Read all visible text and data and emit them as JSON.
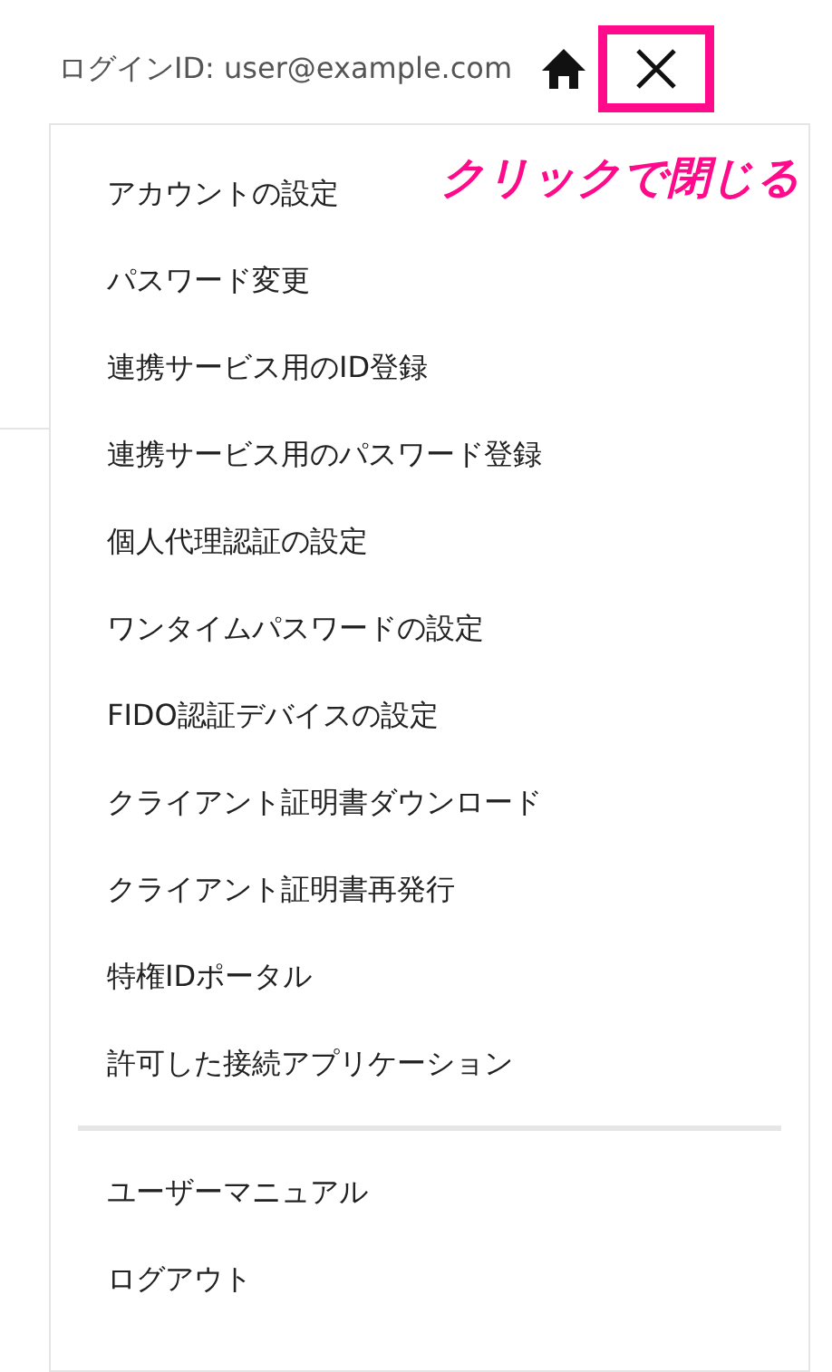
{
  "header": {
    "login_id": "ログインID: user@example.com"
  },
  "callout": {
    "text": "クリックで閉じる"
  },
  "menu": {
    "groups": [
      {
        "items": [
          "アカウントの設定",
          "パスワード変更",
          "連携サービス用のID登録",
          "連携サービス用のパスワード登録",
          "個人代理認証の設定",
          "ワンタイムパスワードの設定",
          "FIDO認証デバイスの設定",
          "クライアント証明書ダウンロード",
          "クライアント証明書再発行",
          "特権IDポータル",
          "許可した接続アプリケーション"
        ]
      },
      {
        "items": [
          "ユーザーマニュアル",
          "ログアウト"
        ]
      }
    ]
  }
}
